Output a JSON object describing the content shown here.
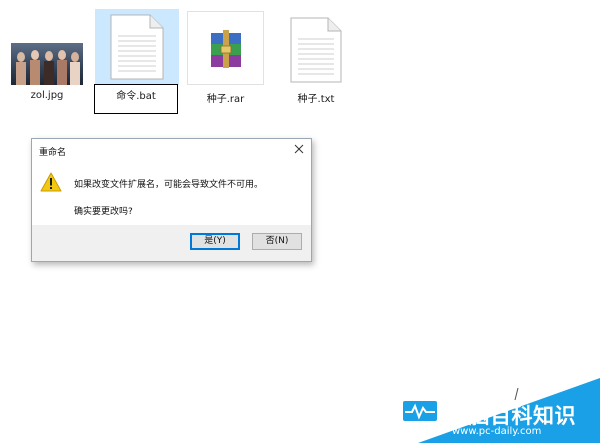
{
  "files": [
    {
      "name": "zol.jpg",
      "icon": "photo-thumbnail-icon"
    },
    {
      "name": "命令.bat",
      "icon": "text-document-icon",
      "selected": true,
      "renaming": true
    },
    {
      "name": "种子.rar",
      "icon": "winrar-archive-icon"
    },
    {
      "name": "种子.txt",
      "icon": "text-document-icon"
    }
  ],
  "dialog": {
    "title": "重命名",
    "message": "如果改变文件扩展名，可能会导致文件不可用。",
    "question": "确实要更改吗?",
    "yes_label": "是(Y)",
    "no_label": "否(N)",
    "icon": "warning-icon"
  },
  "watermark": {
    "brand": "电脑百科知识",
    "url": "www.pc-daily.com",
    "icon": "monitor-pulse-icon"
  },
  "colors": {
    "selection": "#cce8ff",
    "logo_blue": "#1aa0e6",
    "button_focus": "#0078d7",
    "dialog_footer": "#f0f0f0"
  }
}
